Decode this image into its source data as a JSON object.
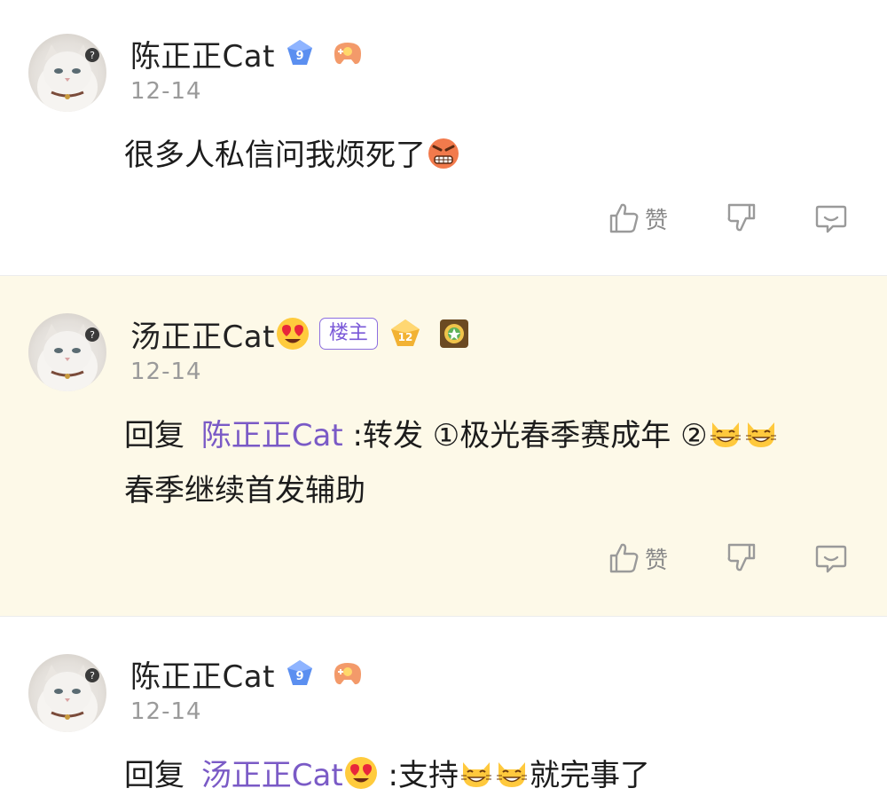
{
  "comments": [
    {
      "username": "陈正正Cat",
      "level": "9",
      "date": "12-14",
      "text": "很多人私信问我烦死了",
      "actions": {
        "like_label": "赞"
      }
    },
    {
      "username": "汤正正Cat",
      "owner_badge": "楼主",
      "level": "12",
      "date": "12-14",
      "reply_prefix": "回复",
      "mention": "陈正正Cat",
      "text_line1": ":转发 ①极光春季赛成年 ②",
      "text_line2": "春季继续首发辅助",
      "actions": {
        "like_label": "赞"
      }
    },
    {
      "username": "陈正正Cat",
      "level": "9",
      "date": "12-14",
      "reply_prefix": "回复",
      "mention": "汤正正Cat",
      "text_a": ":支持",
      "text_b": "就完事了"
    }
  ],
  "colors": {
    "highlight_bg": "#fdf9e8",
    "mention": "#7a5ac6",
    "owner_badge": "#7a58d8",
    "level_blue": "#5b8ff0",
    "level_gold": "#f2b233"
  },
  "icons": [
    "thumb-up-icon",
    "thumb-down-icon",
    "reply-icon",
    "angry-emoji",
    "heart-eyes-emoji",
    "grinning-cat-emoji"
  ]
}
